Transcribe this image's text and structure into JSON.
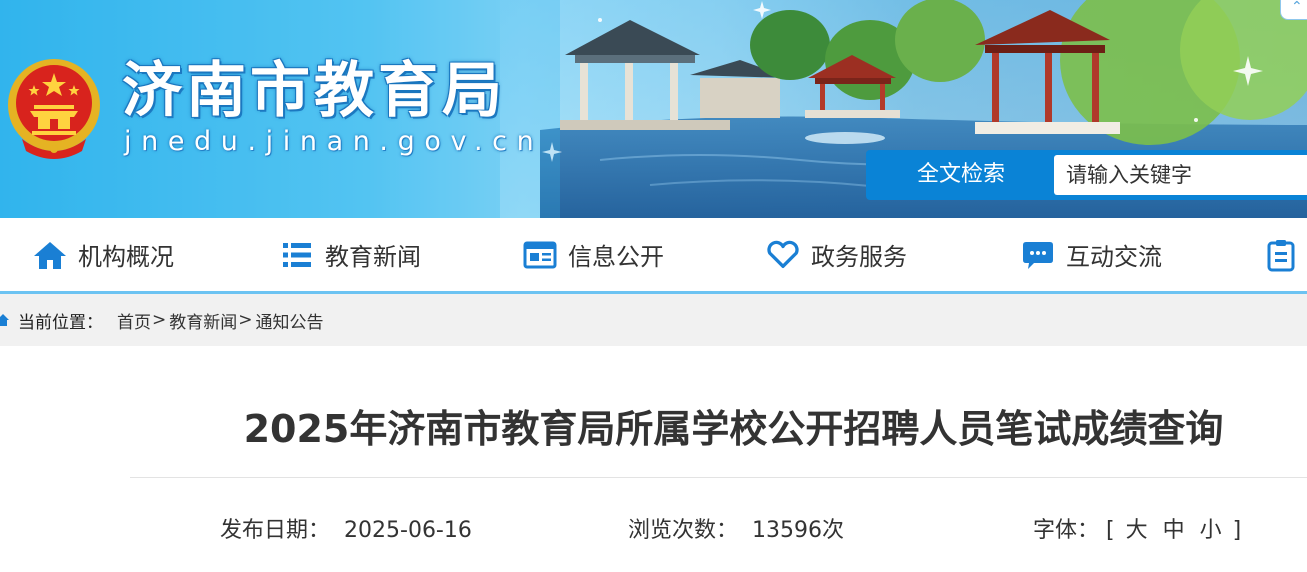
{
  "site": {
    "title": "济南市教育局",
    "url": "jnedu.jinan.gov.cn"
  },
  "search": {
    "label": "全文检索",
    "placeholder": "请输入关键字"
  },
  "nav": {
    "items": [
      {
        "label": "机构概况",
        "icon": "home-icon"
      },
      {
        "label": "教育新闻",
        "icon": "list-icon"
      },
      {
        "label": "信息公开",
        "icon": "newspaper-icon"
      },
      {
        "label": "政务服务",
        "icon": "heart-icon"
      },
      {
        "label": "互动交流",
        "icon": "chat-bubble-icon"
      },
      {
        "label": "",
        "icon": "clipboard-icon"
      }
    ]
  },
  "breadcrumb": {
    "current_label": "当前位置：",
    "items": [
      "首页",
      "教育新闻",
      "通知公告"
    ],
    "separator": ">"
  },
  "article": {
    "title": "2025年济南市教育局所属学校公开招聘人员笔试成绩查询",
    "date_label": "发布日期：",
    "date": "2025-06-16",
    "views_label": "浏览次数：",
    "views": "13596次",
    "font_label": "字体：",
    "font_open": "[",
    "font_large": "大",
    "font_medium": "中",
    "font_small": "小",
    "font_close": "]"
  },
  "colors": {
    "accent": "#0a83d6",
    "nav_icon": "#1a7fd4",
    "nav_line": "#6cc3f2",
    "breadcrumb_bg": "#f1f1f1"
  }
}
